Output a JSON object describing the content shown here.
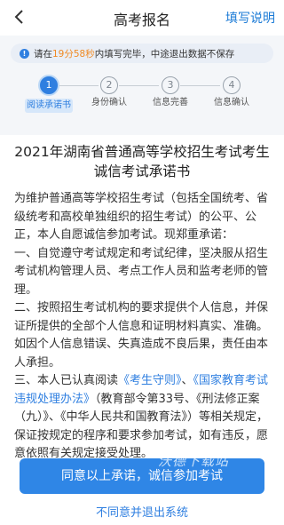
{
  "nav": {
    "title": "高考报名",
    "help_label": "填写说明"
  },
  "notice": {
    "prefix": "请在",
    "timer": "19分58秒",
    "suffix": "内填写完毕，中途退出数据不保存"
  },
  "steps": [
    {
      "num": "1",
      "label": "阅读承诺书"
    },
    {
      "num": "2",
      "label": "身份确认"
    },
    {
      "num": "3",
      "label": "信息完善"
    },
    {
      "num": "4",
      "label": "信息确认"
    }
  ],
  "doc": {
    "title": "2021年湖南省普通高等学校招生考试考生诚信考试承诺书",
    "p1": "为维护普通高等学校招生考试（包括全国统考、省级统考和高校单独组织的招生考试）的公平、公正，本人自愿诚信参加考试。现郑重承诺：",
    "p2": "一、自觉遵守考试规定和考试纪律，坚决服从招生考试机构管理人员、考点工作人员和监考老师的管理。",
    "p3": "二、按照招生考试机构的要求提供个人信息，并保证所提供的全部个人信息和证明材料真实、准确。如因个人信息错误、失真造成不良后果，责任由本人承担。",
    "p4_a": "三、本人已认真阅读",
    "p4_link1": "《考生守则》",
    "p4_b": "、",
    "p4_link2": "《国家教育考试违规处理办法》",
    "p4_c": "（教育部令第33号、《刑法修正案（九）》、《中华人民共和国教育法》）等相关规定，保证按规定的程序和要求参加考试，如有违反，愿意依照有关规定接受处理。"
  },
  "agree_label": "同意以上承诺，诚信参加考试",
  "watermark": "沃德下载站",
  "decline_label": "不同意并退出系统"
}
